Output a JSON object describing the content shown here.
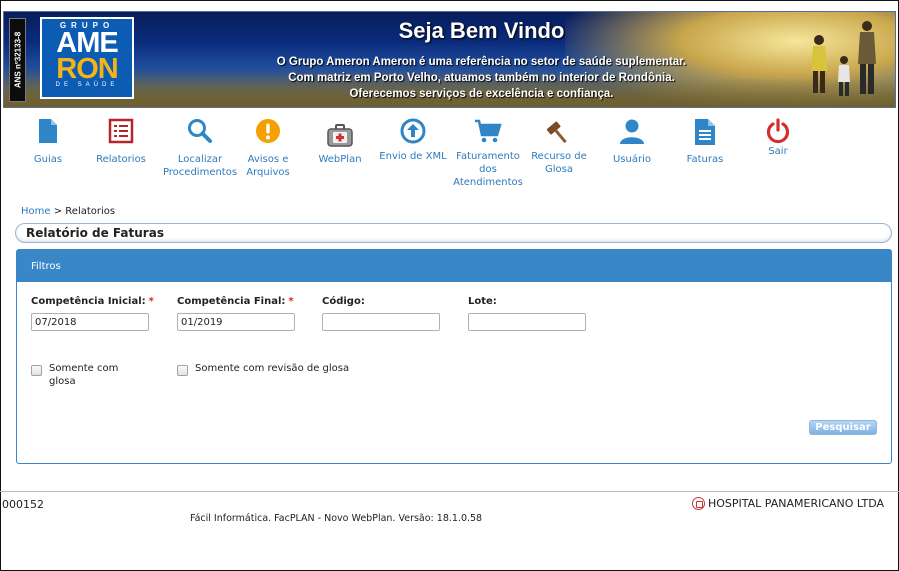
{
  "banner": {
    "ans_label": "ANS nº32133-8",
    "logo_top": "GRUPO",
    "logo_line1": "AME",
    "logo_line2": "RON",
    "logo_bottom": "DE SAÚDE",
    "welcome": "Seja Bem Vindo",
    "tagline": [
      "O Grupo Ameron Ameron é uma referência no setor de saúde suplementar.",
      "Com matriz em Porto Velho, atuamos também no interior de Rondônia.",
      "Oferecemos serviços de excelência e confiança."
    ]
  },
  "nav": [
    {
      "label": "Guias",
      "icon": "document-icon"
    },
    {
      "label": "Relatorios",
      "icon": "report-list-icon"
    },
    {
      "label": "Localizar Procedimentos",
      "icon": "search-icon"
    },
    {
      "label": "Avisos e Arquivos",
      "icon": "alert-icon"
    },
    {
      "label": "WebPlan",
      "icon": "medical-kit-icon"
    },
    {
      "label": "Envio de XML",
      "icon": "upload-icon"
    },
    {
      "label": "Faturamento dos Atendimentos",
      "icon": "cart-icon"
    },
    {
      "label": "Recurso de Glosa",
      "icon": "gavel-icon"
    },
    {
      "label": "Usuário",
      "icon": "user-icon"
    },
    {
      "label": "Faturas",
      "icon": "invoice-icon"
    },
    {
      "label": "Sair",
      "icon": "power-icon"
    }
  ],
  "breadcrumb": {
    "home": "Home",
    "separator": ">",
    "current": "Relatorios"
  },
  "page_title": "Relatório de Faturas",
  "filters": {
    "header": "Filtros",
    "competencia_inicial": {
      "label": "Competência Inicial:",
      "value": "07/2018",
      "required_mark": "*"
    },
    "competencia_final": {
      "label": "Competência Final:",
      "value": "01/2019",
      "required_mark": "*"
    },
    "codigo": {
      "label": "Código:",
      "value": ""
    },
    "lote": {
      "label": "Lote:",
      "value": ""
    },
    "somente_glosa": {
      "label": "Somente com glosa",
      "checked": false
    },
    "somente_revisao": {
      "label": "Somente com revisão de glosa",
      "checked": false
    },
    "search_button": "Pesquisar"
  },
  "footer": {
    "code": "000152",
    "hospital": "HOSPITAL PANAMERICANO LTDA",
    "version": "Fácil Informática. FacPLAN - Novo WebPlan. Versão: 18.1.0.58"
  },
  "colors": {
    "accent": "#3a87c8",
    "nav_label": "#2e7bbd",
    "icon_blue": "#2e86c9",
    "icon_red": "#d32f2f",
    "icon_orange": "#f5a000",
    "required": "#dd2222"
  }
}
